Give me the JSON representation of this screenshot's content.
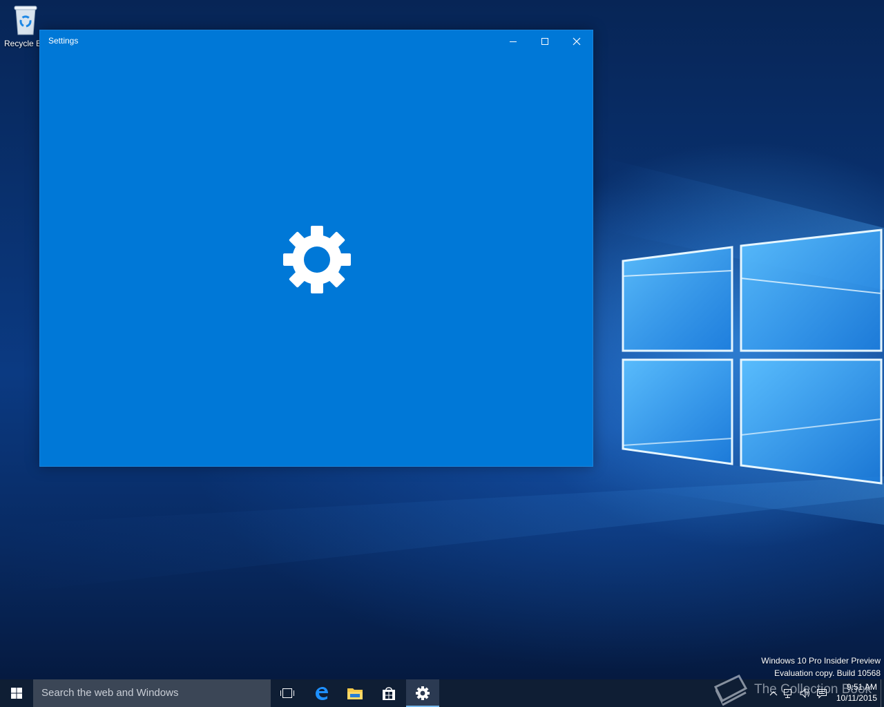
{
  "desktop": {
    "icons": [
      {
        "label": "Recycle Bin"
      }
    ]
  },
  "window": {
    "title": "Settings",
    "controls": {
      "minimize": "minimize-icon",
      "maximize": "maximize-icon",
      "close": "close-icon"
    },
    "splash_icon": "gear-icon",
    "background_color": "#0078d7"
  },
  "watermark": {
    "line1": "Windows 10 Pro Insider Preview",
    "line2": "Evaluation copy. Build 10568"
  },
  "overlay_logo": {
    "text": "The Collection Book"
  },
  "taskbar": {
    "search_placeholder": "Search the web and Windows",
    "pinned": [
      {
        "name": "task-view",
        "icon": "task-view-icon"
      },
      {
        "name": "edge",
        "icon": "edge-icon"
      },
      {
        "name": "file-explorer",
        "icon": "folder-icon"
      },
      {
        "name": "store",
        "icon": "store-icon"
      },
      {
        "name": "settings",
        "icon": "gear-icon",
        "active": true
      }
    ],
    "tray": {
      "icons": [
        "chevron-up-icon",
        "network-icon",
        "volume-icon",
        "action-center-icon"
      ],
      "time": "9:51 AM",
      "date": "10/11/2015"
    },
    "background_color": "#0f1e34"
  }
}
